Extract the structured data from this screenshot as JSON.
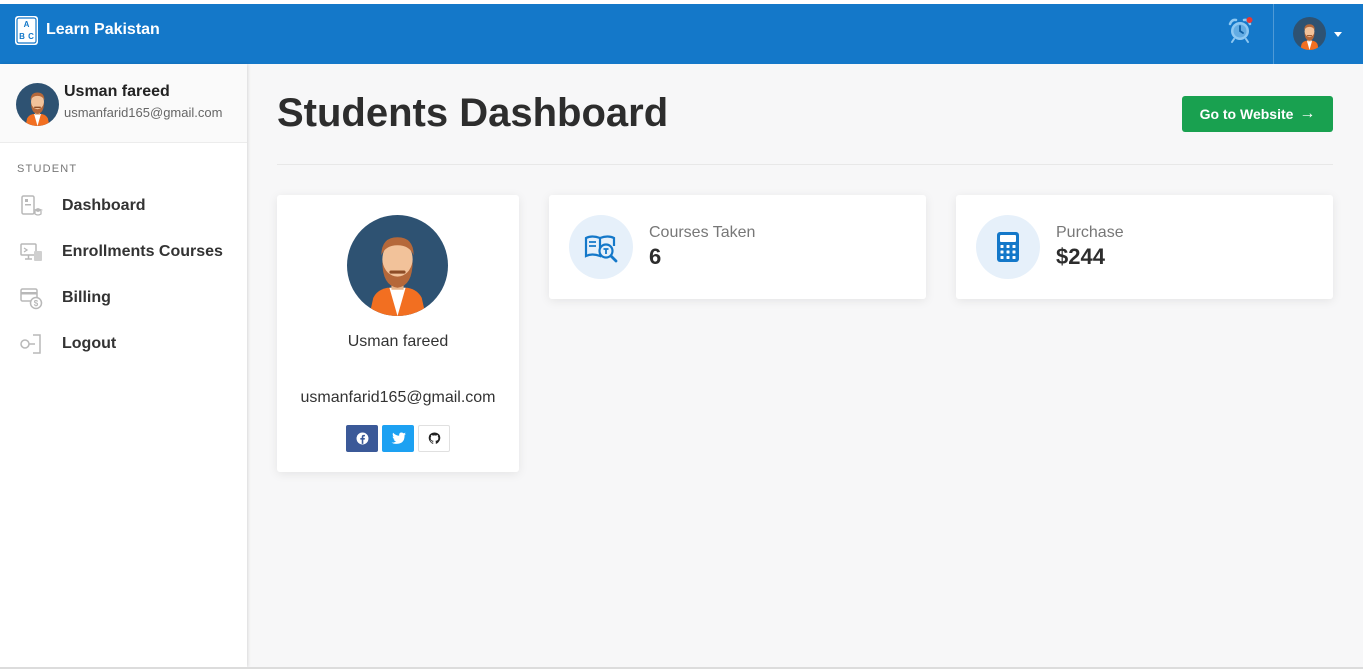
{
  "brand": {
    "name": "Learn Pakistan",
    "logo_letters": [
      "A",
      "B",
      "C"
    ]
  },
  "header": {
    "alarm_icon": "alarm-clock-icon",
    "notification_dot_color": "#e53935",
    "accent_color": "#1478c9"
  },
  "sidebar": {
    "user": {
      "name": "Usman fareed",
      "email": "usmanfarid165@gmail.com"
    },
    "section_label": "STUDENT",
    "items": [
      {
        "label": "Dashboard",
        "icon": "dashboard-icon"
      },
      {
        "label": "Enrollments Courses",
        "icon": "enrollments-icon"
      },
      {
        "label": "Billing",
        "icon": "billing-icon"
      },
      {
        "label": "Logout",
        "icon": "logout-icon"
      }
    ]
  },
  "main": {
    "title": "Students Dashboard",
    "go_button": {
      "label": "Go to Website",
      "color": "#19a150"
    },
    "profile_card": {
      "name": "Usman fareed",
      "email": "usmanfarid165@gmail.com",
      "socials": [
        "facebook-icon",
        "twitter-icon",
        "github-icon"
      ]
    },
    "stats": [
      {
        "label": "Courses Taken",
        "value": "6",
        "icon": "course-book-icon"
      },
      {
        "label": "Purchase",
        "value": "$244",
        "icon": "calculator-icon"
      }
    ]
  }
}
